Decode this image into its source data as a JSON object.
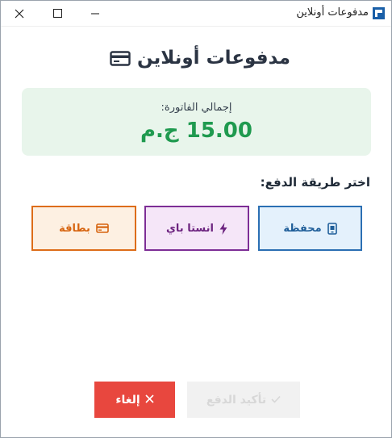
{
  "window": {
    "title": "مدفوعات أونلاين",
    "controls": {
      "close": "close-icon",
      "maximize": "maximize-icon",
      "minimize": "minimize-icon"
    }
  },
  "header": {
    "title": "مدفوعات أونلاين",
    "icon": "card-icon"
  },
  "invoice": {
    "label": "إجمالي الفاتورة:",
    "amount": "15.00 ج.م",
    "bg_color": "#e8f5eb",
    "amount_color": "#1f9a4f"
  },
  "payment": {
    "label": "اختر طريقة الدفع:",
    "methods": [
      {
        "label": "محفظة",
        "icon": "wallet-icon",
        "color": "#2b6fb3"
      },
      {
        "label": "انستا باي",
        "icon": "bolt-icon",
        "color": "#7d2e96"
      },
      {
        "label": "بطاقة",
        "icon": "card-icon",
        "color": "#dd6d19"
      }
    ]
  },
  "actions": {
    "cancel": {
      "label": "إلغاء",
      "icon": "x-icon",
      "color": "#e8473e"
    },
    "confirm": {
      "label": "تأكيد الدفع",
      "icon": "check-icon",
      "disabled": true
    }
  }
}
